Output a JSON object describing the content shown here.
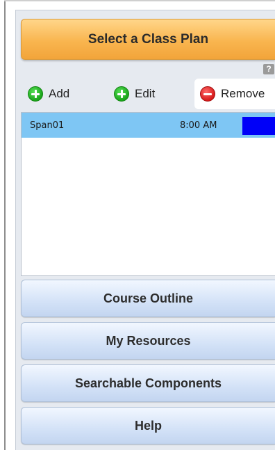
{
  "header": {
    "select_plan_label": "Select a Class Plan",
    "help_glyph": "?"
  },
  "toolbar": {
    "add_label": "Add",
    "edit_label": "Edit",
    "remove_label": "Remove"
  },
  "class_plans": [
    {
      "name": "Span01",
      "time": "8:00 AM",
      "color": "#0000f8"
    }
  ],
  "nav": {
    "course_outline": "Course Outline",
    "my_resources": "My Resources",
    "searchable_components": "Searchable Components",
    "help": "Help"
  },
  "colors": {
    "accent_orange": "#f9b54f",
    "selected_row": "#7ec6f4",
    "nav_button": "#d3e2f7"
  }
}
